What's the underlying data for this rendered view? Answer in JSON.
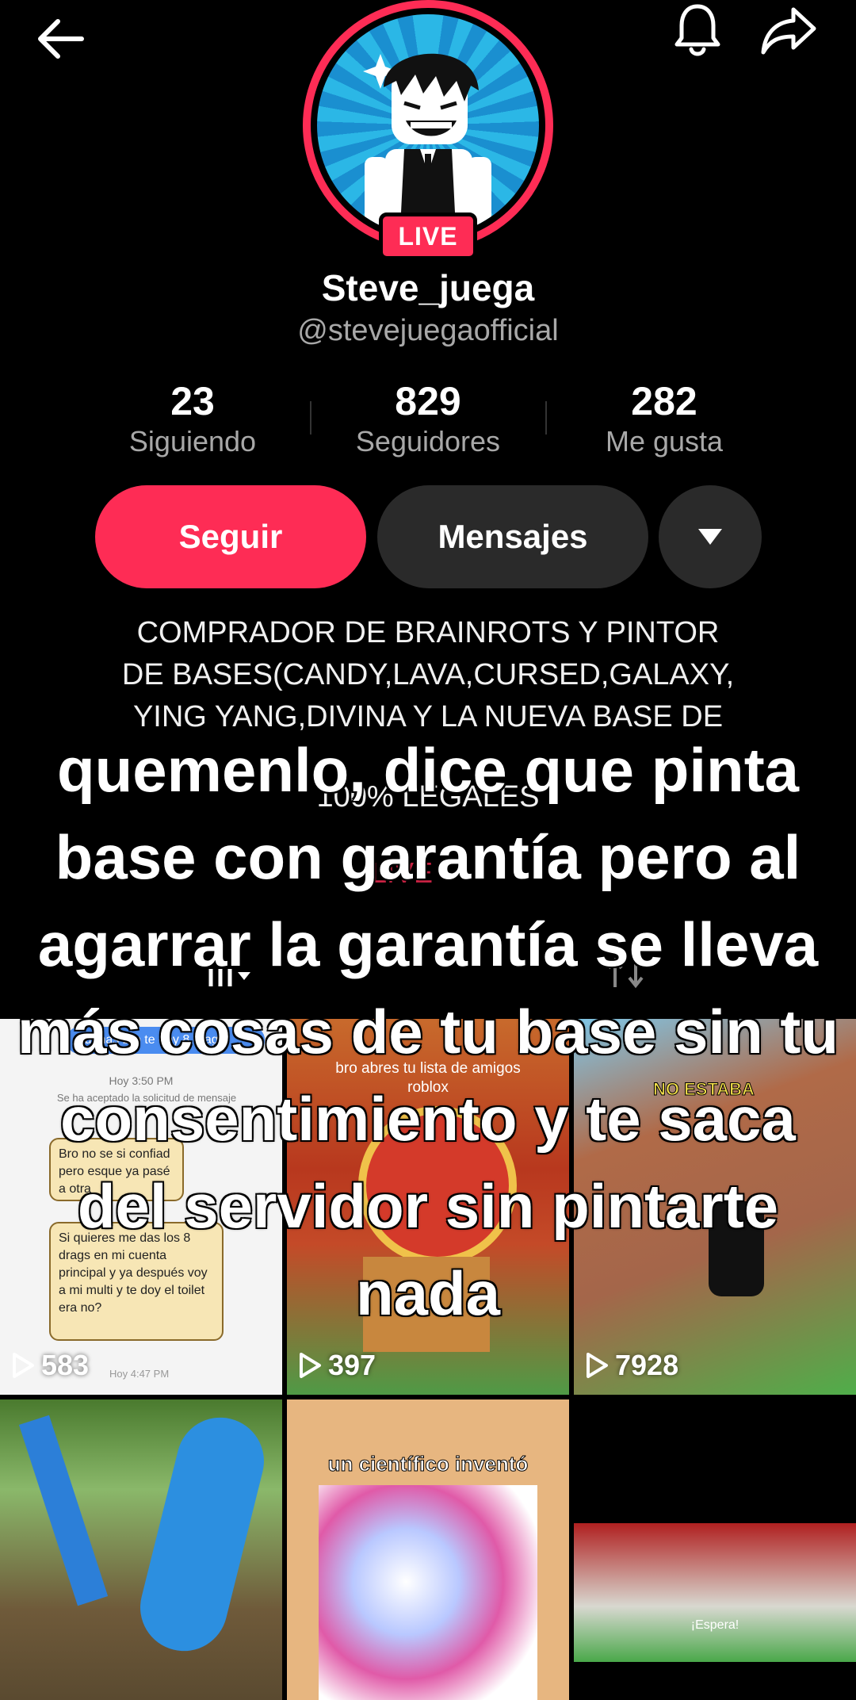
{
  "header": {
    "back_icon": "arrow-left-icon",
    "bell_icon": "bell-icon",
    "share_icon": "share-arrow-icon"
  },
  "profile": {
    "live_badge": "LIVE",
    "display_name": "Steve_juega",
    "handle": "@stevejuegaofficial",
    "stats": {
      "following_count": "23",
      "following_label": "Siguiendo",
      "followers_count": "829",
      "followers_label": "Seguidores",
      "likes_count": "282",
      "likes_label": "Me gusta"
    },
    "buttons": {
      "follow": "Seguir",
      "message": "Mensajes"
    },
    "bio_lines": [
      "COMPRADOR DE BRAINROTS Y PINTOR",
      "DE BASES(CANDY,LAVA,CURSED,GALAXY,",
      "YING YANG,DIVINA Y LA NUEVA BASE DE",
      "100% LEGALES"
    ],
    "live_link": "LIVE"
  },
  "overlay_caption": "quemenlo, dice que pinta base con garantía pero al agarrar la garantía se lleva más cosas de tu base sin tu consentimiento y te saca del servidor sin pintarte nada",
  "videos": [
    {
      "views": "583",
      "texts": {
        "top": "Buenas bro te doy 8 drags",
        "time1": "Hoy 3:50 PM",
        "notice": "Se ha aceptado la solicitud de mensaje",
        "bubble1": "Bro no se si confiad pero esque ya pasé a otra",
        "bubble2": "Si quieres me das los 8 drags en mi cuenta principal y ya después voy a mi multi y te doy el toilet era no?",
        "time2": "Hoy 4:47 PM"
      }
    },
    {
      "views": "397",
      "texts": {
        "top": "bro abres tu lista de amigos",
        "top2": "roblox"
      }
    },
    {
      "views": "7928",
      "texts": {
        "sign": "NO ESTABA"
      }
    },
    {
      "views": "",
      "texts": {}
    },
    {
      "views": "",
      "texts": {
        "top": "un científico inventó"
      }
    },
    {
      "views": "",
      "texts": {
        "hud": "¡Espera!"
      }
    }
  ],
  "colors": {
    "accent": "#fe2c55",
    "secondary_button": "#2a2a2a",
    "muted_text": "#a8a8a8"
  }
}
